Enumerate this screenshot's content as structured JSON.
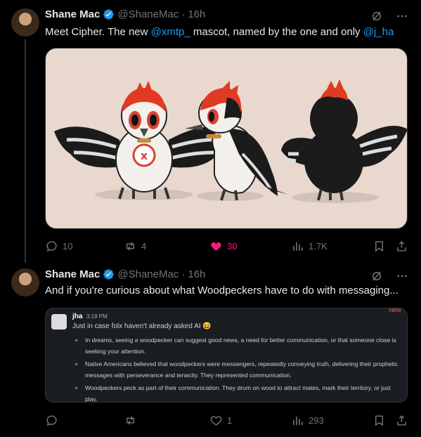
{
  "tweets": [
    {
      "author": "Shane Mac",
      "handle": "@ShaneMac",
      "separator": "·",
      "time": "16h",
      "text_parts": [
        "Meet Cipher. The new ",
        "@xmtp_",
        " mascot, named by the one and only ",
        "@j_ha"
      ],
      "actions": {
        "replies": "10",
        "reposts": "4",
        "likes": "30",
        "views": "1.7K"
      }
    },
    {
      "author": "Shane Mac",
      "handle": "@ShaneMac",
      "separator": "·",
      "time": "16h",
      "text": "And if you're curious about what Woodpeckers have to do with messaging...",
      "quote": {
        "name": "jha",
        "time": "3:19 PM",
        "new_label": "New",
        "intro": "Just in case folx haven't already asked AI 😆",
        "bullets": [
          "In dreams, seeing a woodpecker can suggest good news, a need for better communication, or that someone close is seeking your attention.",
          "Native Americans believed that woodpeckers were messengers, repeatedly conveying truth, delivering their prophetic messages with perseverance and tenacity. They represented communication.",
          "Woodpeckers peck as part of their communication. They drum on wood to attract mates, mark their territory, or just play."
        ]
      },
      "actions": {
        "replies": "",
        "reposts": "",
        "likes": "1",
        "views": "293"
      }
    }
  ],
  "colors": {
    "accent": "#1d9bf0",
    "like": "#f91880",
    "muted": "#71767b",
    "background": "#000000"
  },
  "icons": [
    "verified-badge-icon",
    "grok-icon",
    "more-icon",
    "reply-icon",
    "repost-icon",
    "like-icon",
    "views-icon",
    "bookmark-icon",
    "share-icon"
  ]
}
